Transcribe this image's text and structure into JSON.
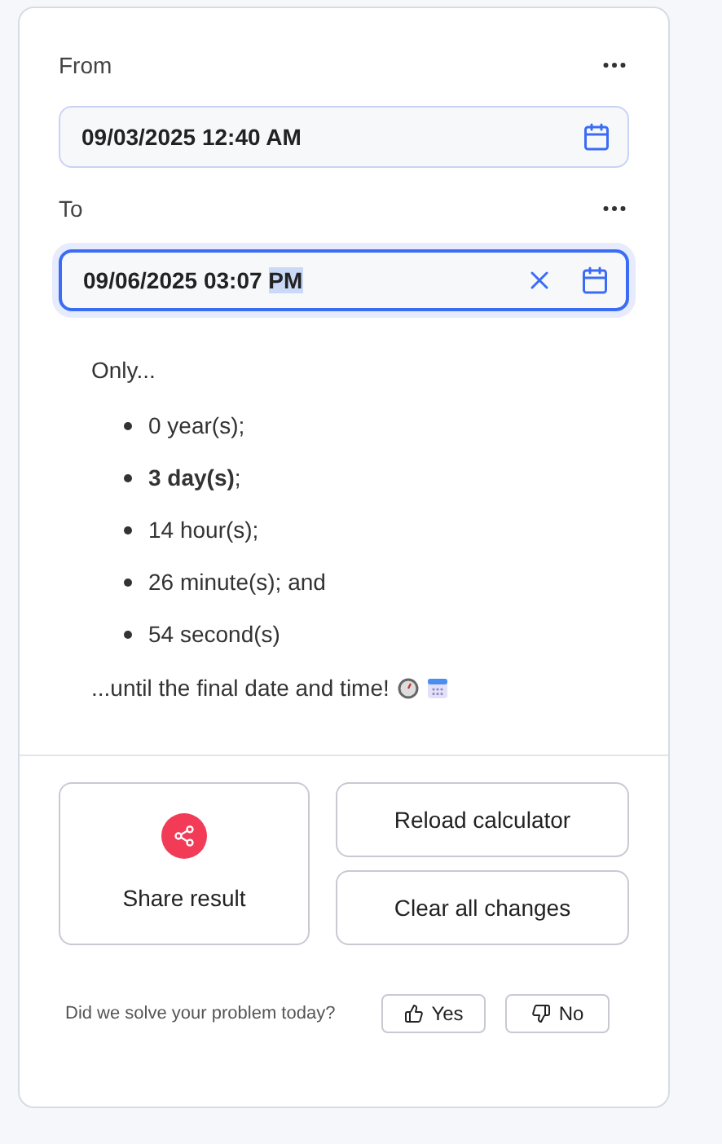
{
  "fields": [
    {
      "label": "From",
      "value": "09/03/2025 12:40 AM",
      "focused": false,
      "clearable": false
    },
    {
      "label": "To",
      "value": "09/06/2025 03:07 ",
      "highlighted": "PM",
      "focused": true,
      "clearable": true
    }
  ],
  "result": {
    "intro": "Only...",
    "items": [
      "0 year(s);",
      "**3 day(s)**;",
      "14 hour(s);",
      "26 minute(s); and",
      "54 second(s)"
    ],
    "outro": "...until the final date and time!"
  },
  "actions": {
    "share": "Share result",
    "reload": "Reload calculator",
    "clear": "Clear all changes"
  },
  "feedback": {
    "question": "Did we solve your problem today?",
    "yes": "Yes",
    "no": "No"
  }
}
